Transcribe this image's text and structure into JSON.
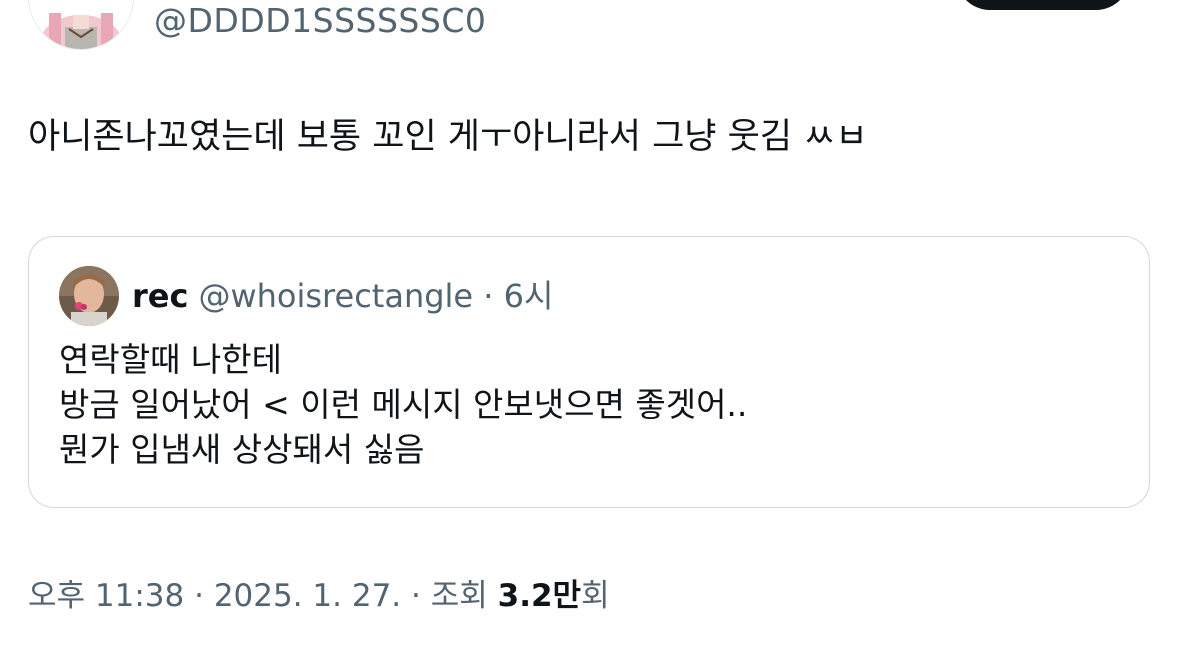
{
  "author": {
    "handle": "@DDDD1SSSSSSC0"
  },
  "tweet": {
    "text": "아니존나꼬였는데 보통 꼬인 게ㅜ아니라서 그냥 웃김 ㅆㅂ"
  },
  "quote": {
    "name": "rec",
    "handle": "@whoisrectangle",
    "separator": "·",
    "time": "6시",
    "lines": [
      "연락할때 나한테",
      "방금 일어났어 < 이런 메시지 안보냇으면 좋겟어..",
      "뭔가 입냄새 상상돼서 싫음"
    ]
  },
  "meta": {
    "time": "오후 11:38",
    "date": "2025. 1. 27.",
    "views_label": "조회",
    "views_count": "3.2만",
    "views_unit": "회",
    "separator": "·"
  },
  "icons": {
    "author_avatar": "avatar-anime-character-icon",
    "quote_avatar": "avatar-photo-icon"
  },
  "colors": {
    "text_primary": "#0f1419",
    "text_secondary": "#536471",
    "border": "#cfd9de",
    "button_dark": "#0f1419"
  }
}
